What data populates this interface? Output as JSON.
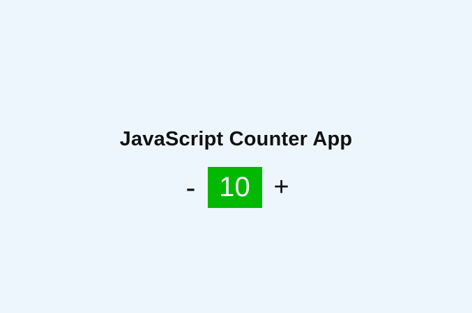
{
  "app": {
    "title": "JavaScript Counter App"
  },
  "counter": {
    "decrement_label": "-",
    "value": "10",
    "increment_label": "+"
  },
  "colors": {
    "background": "#eef6fd",
    "count_background": "#00b900",
    "count_text": "#ffffff",
    "text": "#111111"
  }
}
